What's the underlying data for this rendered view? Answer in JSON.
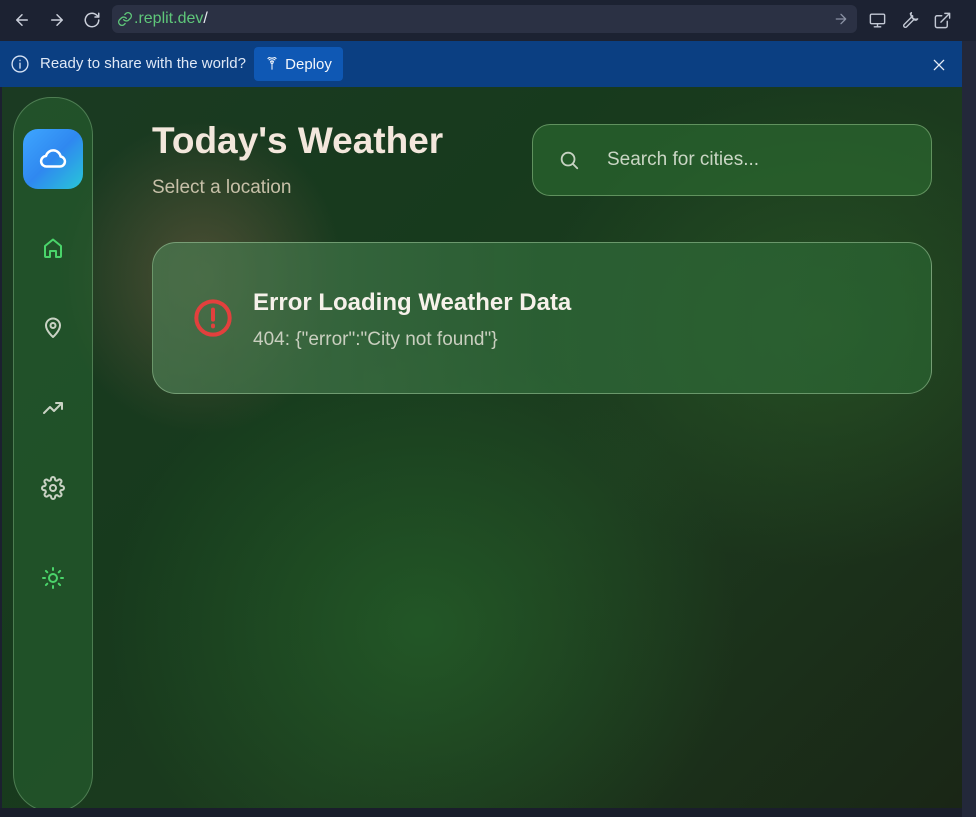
{
  "browser": {
    "url_domain": ".replit.dev",
    "url_path": "/",
    "icons": [
      "back-icon",
      "forward-icon",
      "reload-icon",
      "link-icon",
      "go-arrow-icon",
      "monitor-icon",
      "wrench-icon",
      "external-link-icon"
    ]
  },
  "banner": {
    "message": "Ready to share with the world?",
    "deploy_label": "Deploy",
    "bg_color": "#0b3f82",
    "button_color": "#0f58b4"
  },
  "sidebar": {
    "items": [
      {
        "name": "home",
        "icon": "home-icon",
        "active": true,
        "color": "#4ad46a"
      },
      {
        "name": "locations",
        "icon": "map-pin-icon",
        "active": false,
        "color": "#c9d2c4"
      },
      {
        "name": "trends",
        "icon": "trending-up-icon",
        "active": false,
        "color": "#c9d2c4"
      },
      {
        "name": "settings",
        "icon": "gear-icon",
        "active": false,
        "color": "#c9d2c4"
      },
      {
        "name": "theme",
        "icon": "sun-icon",
        "active": false,
        "color": "#4ad46a"
      }
    ],
    "logo_icon": "cloud-icon"
  },
  "header": {
    "title": "Today's Weather",
    "subtitle": "Select a location"
  },
  "search": {
    "placeholder": "Search for cities...",
    "value": ""
  },
  "error": {
    "title": "Error Loading Weather Data",
    "message": "404: {\"error\":\"City not found\"}",
    "icon": "alert-circle-icon",
    "color": "#e2403d"
  }
}
